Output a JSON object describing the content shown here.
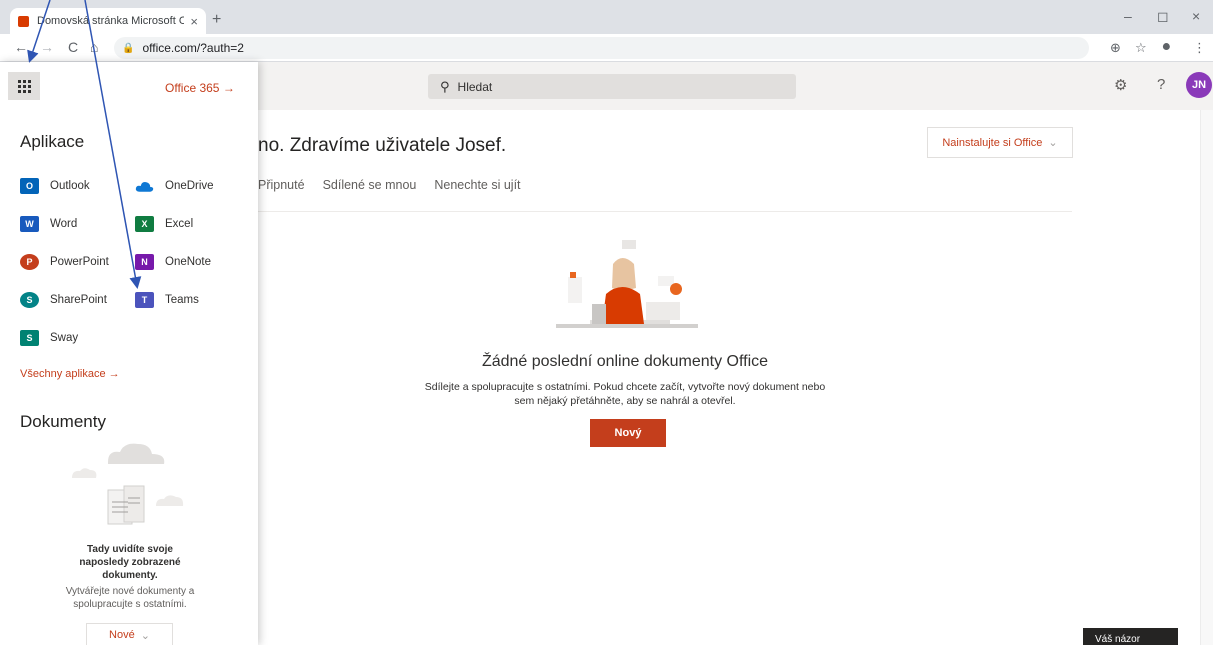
{
  "browser": {
    "tab_title": "Domovská stránka Microsoft Offi",
    "tab_close": "×",
    "new_tab": "+",
    "back": "←",
    "forward": "→",
    "reload": "C",
    "home": "⌂",
    "url": "office.com/?auth=2",
    "win_min": "–",
    "win_max": "◻",
    "win_close": "×"
  },
  "header": {
    "office365_label": "Office 365 →",
    "search_placeholder": "Hledat",
    "settings_icon": "⚙",
    "help_icon": "?",
    "avatar_initials": "JN"
  },
  "main": {
    "greeting": "no. Zdravíme uživatele Josef.",
    "install_label": "Nainstalujte si Office",
    "filters": [
      "Připnuté",
      "Sdílené se mnou",
      "Nenechte si ujít"
    ],
    "empty_title": "Žádné poslední online dokumenty Office",
    "empty_desc_line1": "Sdílejte a spolupracujte s ostatními. Pokud chcete začít, vytvořte nový dokument nebo",
    "empty_desc_line2": "sem nějaký přetáhněte, aby se nahrál a otevřel.",
    "new_button": "Nový",
    "feedback_button": "Váš názor"
  },
  "panel": {
    "apps_title": "Aplikace",
    "apps": [
      {
        "name": "Outlook",
        "icon": "O",
        "color": "#0364b8"
      },
      {
        "name": "OneDrive",
        "icon": "cloud",
        "color": "#0f78d4"
      },
      {
        "name": "Word",
        "icon": "W",
        "color": "#185abd"
      },
      {
        "name": "Excel",
        "icon": "X",
        "color": "#107c41"
      },
      {
        "name": "PowerPoint",
        "icon": "P",
        "color": "#c43e1c"
      },
      {
        "name": "OneNote",
        "icon": "N",
        "color": "#7719aa"
      },
      {
        "name": "SharePoint",
        "icon": "S",
        "color": "#038387"
      },
      {
        "name": "Teams",
        "icon": "T",
        "color": "#4b53bc"
      },
      {
        "name": "Sway",
        "icon": "S",
        "color": "#008272"
      }
    ],
    "all_apps": "Všechny aplikace →",
    "docs_title": "Dokumenty",
    "docs_head_line1": "Tady uvidíte svoje",
    "docs_head_line2": "naposledy zobrazené",
    "docs_head_line3": "dokumenty.",
    "docs_sub_line1": "Vytvářejte nové dokumenty a",
    "docs_sub_line2": "spolupracujte s ostatními.",
    "new_docs_button": "Nové"
  },
  "colors": {
    "accent": "#c43e1c",
    "header_bg": "#f3f2f1",
    "avatar": "#8a3ab9",
    "arrow": "#2f55b3"
  }
}
